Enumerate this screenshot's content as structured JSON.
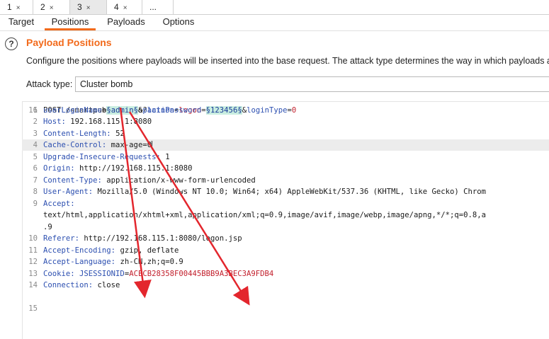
{
  "top_tabs": [
    {
      "label": "1",
      "close": "×"
    },
    {
      "label": "2",
      "close": "×"
    },
    {
      "label": "3",
      "close": "×"
    },
    {
      "label": "4",
      "close": "×"
    },
    {
      "label": "...",
      "close": ""
    }
  ],
  "sub_tabs": [
    "Target",
    "Positions",
    "Payloads",
    "Options"
  ],
  "help_glyph": "?",
  "section_title": "Payload Positions",
  "description": "Configure the positions where payloads will be inserted into the base request. The attack type determines the way in which payloads are as",
  "attack_type": {
    "label": "Attack type:",
    "value": "Cluster bomb"
  },
  "request_lines": [
    {
      "num": "1",
      "parts": [
        {
          "t": "POST /smartpub/user.do?",
          "c": "plain"
        },
        {
          "t": "action",
          "c": "key"
        },
        {
          "t": "=",
          "c": "plain"
        },
        {
          "t": "logon",
          "c": "val"
        },
        {
          "t": " HTTP/1.1",
          "c": "plain"
        }
      ]
    },
    {
      "num": "2",
      "parts": [
        {
          "t": "Host: ",
          "c": "key"
        },
        {
          "t": "192.168.115.1:8080",
          "c": "plain"
        }
      ]
    },
    {
      "num": "3",
      "parts": [
        {
          "t": "Content-Length: ",
          "c": "key"
        },
        {
          "t": "52",
          "c": "plain"
        }
      ]
    },
    {
      "num": "4",
      "parts": [
        {
          "t": "Cache-Control: ",
          "c": "key"
        },
        {
          "t": "max-age=0",
          "c": "plain"
        }
      ]
    },
    {
      "num": "5",
      "parts": [
        {
          "t": "Upgrade-Insecure-Requests: ",
          "c": "key"
        },
        {
          "t": "1",
          "c": "plain"
        }
      ]
    },
    {
      "num": "6",
      "parts": [
        {
          "t": "Origin: ",
          "c": "key"
        },
        {
          "t": "http://192.168.115.1:8080",
          "c": "plain"
        }
      ]
    },
    {
      "num": "7",
      "parts": [
        {
          "t": "Content-Type: ",
          "c": "key"
        },
        {
          "t": "application/x-www-form-urlencoded",
          "c": "plain"
        }
      ]
    },
    {
      "num": "8",
      "parts": [
        {
          "t": "User-Agent: ",
          "c": "key"
        },
        {
          "t": "Mozilla/5.0 (Windows NT 10.0; Win64; x64) AppleWebKit/537.36 (KHTML, like Gecko) Chrom",
          "c": "plain"
        }
      ]
    },
    {
      "num": "9",
      "parts": [
        {
          "t": "Accept:",
          "c": "key"
        }
      ]
    },
    {
      "num": "",
      "parts": [
        {
          "t": "text/html,application/xhtml+xml,application/xml;q=0.9,image/avif,image/webp,image/apng,*/*;q=0.8,a",
          "c": "plain"
        }
      ]
    },
    {
      "num": "",
      "parts": [
        {
          "t": ".9",
          "c": "plain"
        }
      ]
    },
    {
      "num": "10",
      "parts": [
        {
          "t": "Referer: ",
          "c": "key"
        },
        {
          "t": "http://192.168.115.1:8080/logon.jsp",
          "c": "plain"
        }
      ]
    },
    {
      "num": "11",
      "parts": [
        {
          "t": "Accept-Encoding: ",
          "c": "key"
        },
        {
          "t": "gzip, deflate",
          "c": "plain"
        }
      ]
    },
    {
      "num": "12",
      "parts": [
        {
          "t": "Accept-Language: ",
          "c": "key"
        },
        {
          "t": "zh-CN,zh;q=0.9",
          "c": "plain"
        }
      ]
    },
    {
      "num": "13",
      "parts": [
        {
          "t": "Cookie: ",
          "c": "key"
        },
        {
          "t": "JSESSIONID",
          "c": "key"
        },
        {
          "t": "=",
          "c": "plain"
        },
        {
          "t": "ACECB28358F00445BBB9A3BEC3A9FDB4",
          "c": "val"
        }
      ]
    },
    {
      "num": "14",
      "parts": [
        {
          "t": "Connection: ",
          "c": "key"
        },
        {
          "t": "close",
          "c": "plain"
        }
      ]
    },
    {
      "num": "15",
      "parts": []
    },
    {
      "num": "16",
      "parts": [
        {
          "t": "userLoginName",
          "c": "key"
        },
        {
          "t": "=",
          "c": "plain"
        },
        {
          "t": "§admin§",
          "c": "marker"
        },
        {
          "t": "&",
          "c": "plain"
        },
        {
          "t": "plainPassword",
          "c": "key"
        },
        {
          "t": "=",
          "c": "plain"
        },
        {
          "t": "§123456§",
          "c": "marker"
        },
        {
          "t": "&",
          "c": "plain"
        },
        {
          "t": "loginType",
          "c": "key"
        },
        {
          "t": "=",
          "c": "plain"
        },
        {
          "t": "0",
          "c": "val"
        }
      ]
    }
  ],
  "colors": {
    "accent": "#f26a1b",
    "key": "#2c4fb0",
    "value": "#c21f2c",
    "marker_bg": "#c9eee0",
    "arrow": "#e3262d"
  }
}
